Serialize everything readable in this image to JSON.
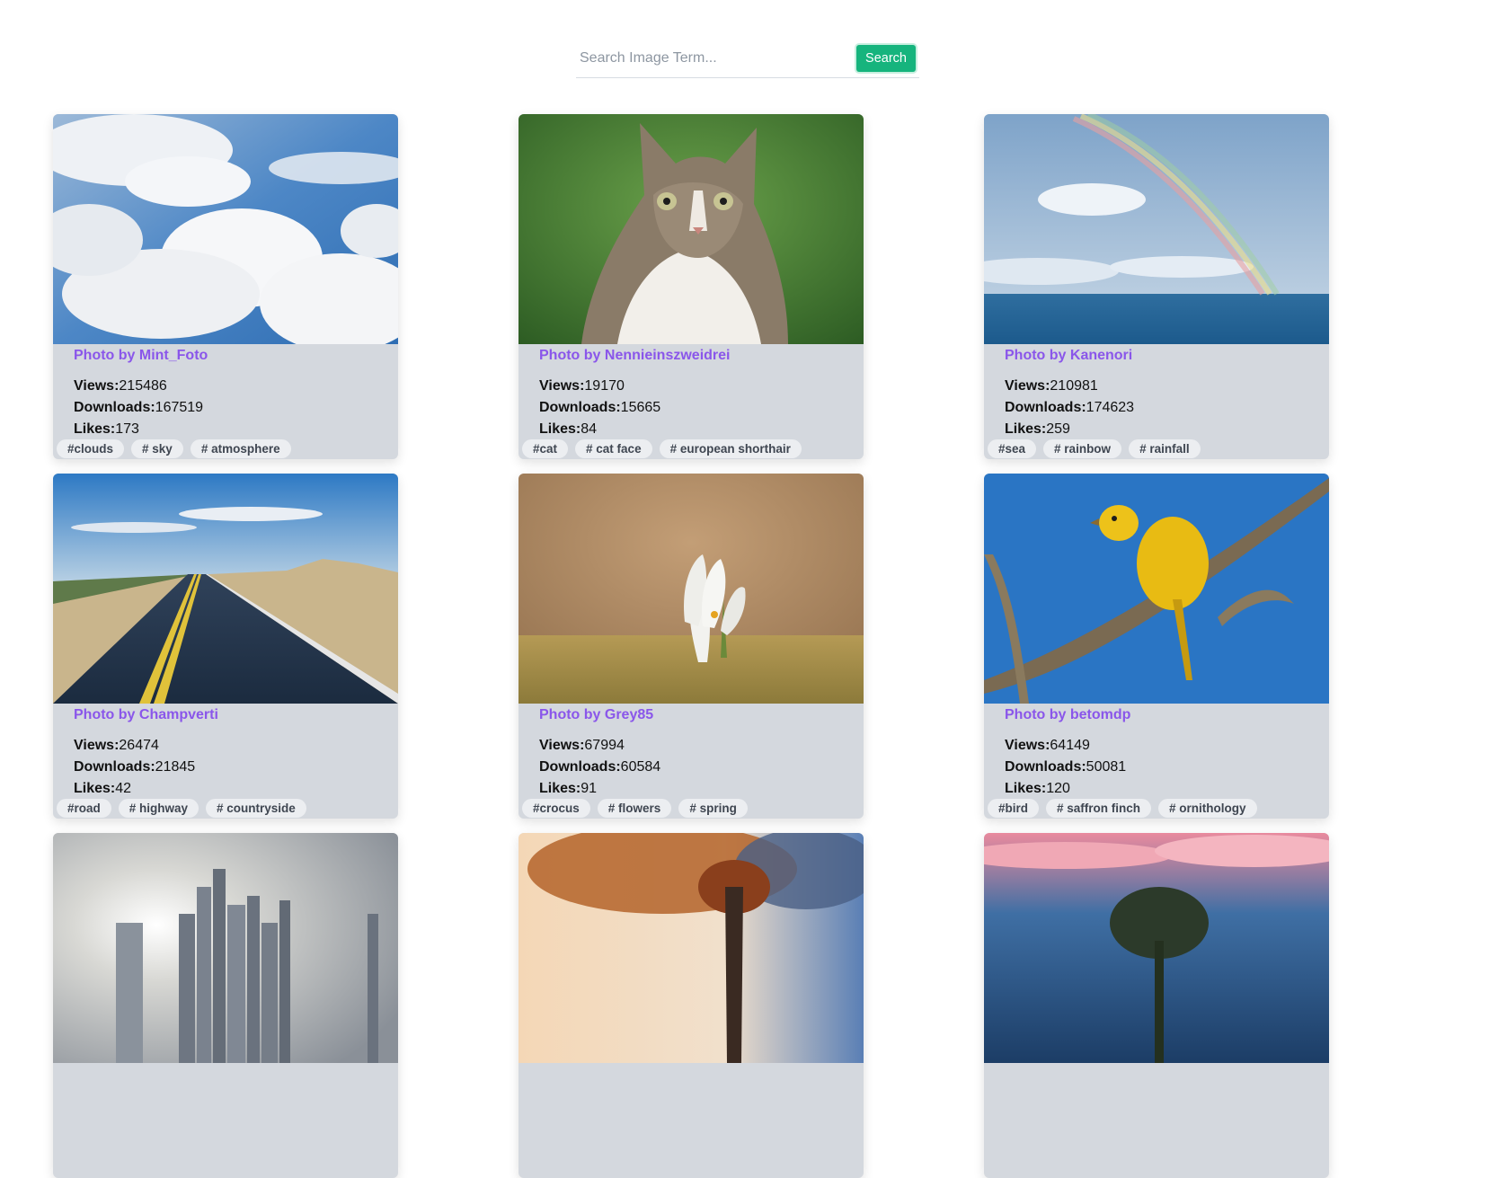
{
  "search": {
    "placeholder": "Search Image Term...",
    "value": "",
    "button_label": "Search"
  },
  "colors": {
    "accent_green": "#16b47d",
    "credit_purple": "#8a56ea",
    "card_bg": "#d4d8de",
    "tag_bg": "#eceef1"
  },
  "cards": [
    {
      "credit": "Photo by Mint_Foto",
      "views_label": "Views:",
      "views": "215486",
      "downloads_label": "Downloads:",
      "downloads": "167519",
      "likes_label": "Likes:",
      "likes": "173",
      "tags": [
        "#clouds",
        "# sky",
        "# atmosphere"
      ],
      "image": "clouds-sky-photo"
    },
    {
      "credit": "Photo by Nennieinszweidrei",
      "views_label": "Views:",
      "views": "19170",
      "downloads_label": "Downloads:",
      "downloads": "15665",
      "likes_label": "Likes:",
      "likes": "84",
      "tags": [
        "#cat",
        "# cat face",
        "# european shorthair"
      ],
      "image": "cat-photo"
    },
    {
      "credit": "Photo by Kanenori",
      "views_label": "Views:",
      "views": "210981",
      "downloads_label": "Downloads:",
      "downloads": "174623",
      "likes_label": "Likes:",
      "likes": "259",
      "tags": [
        "#sea",
        "# rainbow",
        "# rainfall"
      ],
      "image": "rainbow-sea-photo"
    },
    {
      "credit": "Photo by Champverti",
      "views_label": "Views:",
      "views": "26474",
      "downloads_label": "Downloads:",
      "downloads": "21845",
      "likes_label": "Likes:",
      "likes": "42",
      "tags": [
        "#road",
        "# highway",
        "# countryside"
      ],
      "image": "highway-photo"
    },
    {
      "credit": "Photo by Grey85",
      "views_label": "Views:",
      "views": "67994",
      "downloads_label": "Downloads:",
      "downloads": "60584",
      "likes_label": "Likes:",
      "likes": "91",
      "tags": [
        "#crocus",
        "# flowers",
        "# spring"
      ],
      "image": "crocus-photo"
    },
    {
      "credit": "Photo by betomdp",
      "views_label": "Views:",
      "views": "64149",
      "downloads_label": "Downloads:",
      "downloads": "50081",
      "likes_label": "Likes:",
      "likes": "120",
      "tags": [
        "#bird",
        "# saffron finch",
        "# ornithology"
      ],
      "image": "bird-photo"
    },
    {
      "image": "city-skyline-photo"
    },
    {
      "image": "autumn-tree-photo"
    },
    {
      "image": "sunset-tree-photo"
    }
  ]
}
